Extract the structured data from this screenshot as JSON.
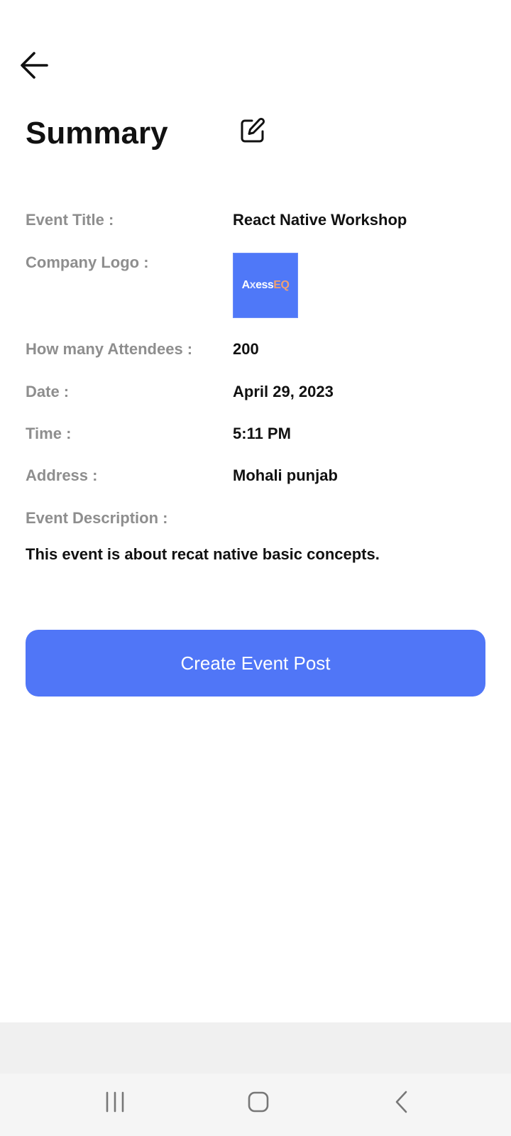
{
  "header": {
    "title": "Summary",
    "back_icon": "arrow-left-icon",
    "edit_icon": "edit-icon"
  },
  "details": {
    "event_title_label": "Event Title :",
    "event_title_value": "React Native Workshop",
    "company_logo_label": "Company Logo :",
    "company_logo": {
      "text_a": "A",
      "text_c": "x",
      "text_ess": "ess",
      "text_eq": "EQ",
      "background": "#4f78f8"
    },
    "attendees_label": "How many Attendees :",
    "attendees_value": "200",
    "date_label": "Date :",
    "date_value": "April 29, 2023",
    "time_label": "Time :",
    "time_value": "5:11 PM",
    "address_label": "Address :",
    "address_value": "Mohali punjab",
    "description_label": "Event Description :",
    "description_value": "This event is about recat native basic concepts."
  },
  "actions": {
    "create_label": "Create Event Post",
    "button_color": "#5076f7"
  },
  "system_nav": {
    "recents_icon": "recents-icon",
    "home_icon": "home-icon",
    "back_icon": "system-back-icon"
  }
}
